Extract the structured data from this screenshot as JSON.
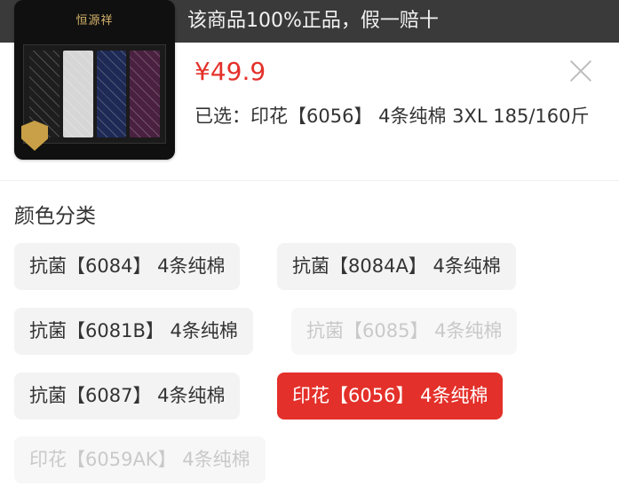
{
  "banner": {
    "text": "该商品100%正品，假一赔十"
  },
  "product": {
    "brand": "恒源祥",
    "price": "¥49.9",
    "selected_text": "已选：印花【6056】 4条纯棉 3XL 185/160斤"
  },
  "sku": {
    "section_title": "颜色分类",
    "options": [
      {
        "label": "抗菌【6084】 4条纯棉",
        "state": "normal"
      },
      {
        "label": "抗菌【8084A】 4条纯棉",
        "state": "normal"
      },
      {
        "label": "抗菌【6081B】 4条纯棉",
        "state": "normal"
      },
      {
        "label": "抗菌【6085】 4条纯棉",
        "state": "disabled"
      },
      {
        "label": "抗菌【6087】 4条纯棉",
        "state": "normal"
      },
      {
        "label": "印花【6056】 4条纯棉",
        "state": "selected"
      },
      {
        "label": "印花【6059AK】 4条纯棉",
        "state": "disabled"
      }
    ]
  },
  "colors": {
    "accent": "#e4302a",
    "banner_bg": "#3a3a3a"
  }
}
